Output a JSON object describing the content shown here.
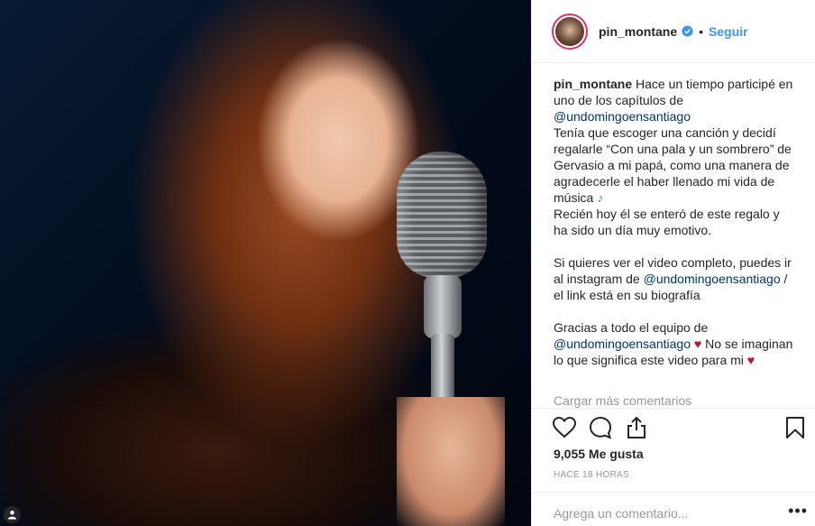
{
  "header": {
    "username": "pin_montane",
    "verified_icon": "verified-badge-icon",
    "separator": "•",
    "follow_label": "Seguir"
  },
  "caption": {
    "username": "pin_montane",
    "l1_text": " Hace un tiempo participé en uno de los capítulos de ",
    "l1_mention": "@undomingoensantiago",
    "l2_text": "Tenía que escoger una canción y decidí regalarle “Con una pala y un sombrero” de Gervasio a mi papá, como una manera de agradecerle el haber llenado mi vida de música ",
    "l2_note": "♪",
    "l3_text": "Recién hoy él se enteró de este regalo y ha sido un día muy emotivo.",
    "l4_text": "Si quieres ver el video completo, puedes ir al instagram de ",
    "l4_mention": "@undomingoensantiago",
    "l4_after": " / el link está en su biografía",
    "l5_text": "Gracias a todo el equipo de ",
    "l5_mention": "@undomingoensantiago",
    "l5_heart": " ♥",
    "l5_after": " No se imaginan lo que significa este video para mi ",
    "l5_heart2": "♥"
  },
  "load_more": "Cargar más comentarios",
  "actions": {
    "like_icon": "heart-icon",
    "comment_icon": "comment-icon",
    "share_icon": "share-icon",
    "save_icon": "bookmark-icon"
  },
  "likes": "9,055 Me gusta",
  "timestamp": "HACE 18 HORAS",
  "comment_placeholder": "Agrega un comentario...",
  "more_options": "•••",
  "colors": {
    "accent": "#3897f0",
    "mention": "#003569",
    "heart": "#c0102d",
    "muted": "#999999"
  }
}
